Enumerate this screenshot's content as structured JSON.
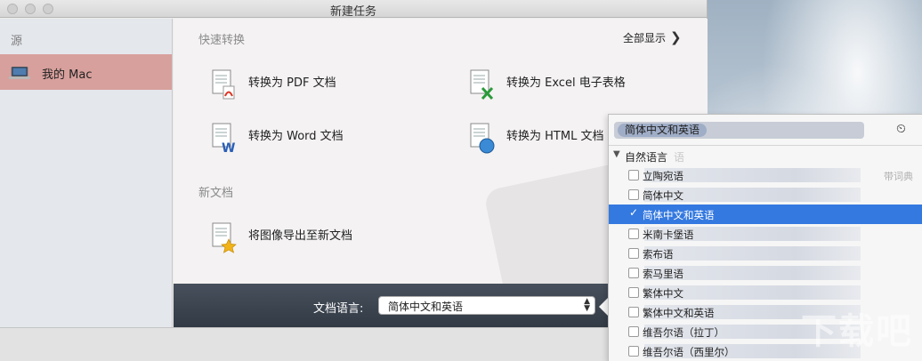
{
  "window": {
    "title": "新建任务"
  },
  "sidebar": {
    "header": "源",
    "items": [
      {
        "label": "我的 Mac",
        "icon": "laptop-icon",
        "selected": true
      }
    ]
  },
  "quick_convert": {
    "title": "快速转换",
    "show_all": "全部显示",
    "actions": [
      {
        "label": "转换为 PDF 文档",
        "icon": "pdf-doc-icon"
      },
      {
        "label": "转换为 Excel 电子表格",
        "icon": "excel-doc-icon"
      },
      {
        "label": "转换为 Word 文档",
        "icon": "word-doc-icon"
      },
      {
        "label": "转换为 HTML 文档",
        "icon": "html-doc-icon"
      }
    ]
  },
  "new_document": {
    "title": "新文档",
    "actions": [
      {
        "label": "将图像导出至新文档",
        "icon": "image-export-icon"
      }
    ]
  },
  "bottombar": {
    "language_label": "文档语言:",
    "language_value": "简体中文和英语"
  },
  "popover": {
    "search_chip": "简体中文和英语",
    "group_label": "自然语言",
    "group_ghost": "语",
    "languages": [
      {
        "name": "立陶宛语",
        "checked": false,
        "selected": false,
        "dict": "带词典"
      },
      {
        "name": "简体中文",
        "checked": false,
        "selected": false
      },
      {
        "name": "简体中文和英语",
        "checked": true,
        "selected": true
      },
      {
        "name": "米南卡堡语",
        "checked": false,
        "selected": false
      },
      {
        "name": "索布语",
        "checked": false,
        "selected": false
      },
      {
        "name": "索马里语",
        "checked": false,
        "selected": false
      },
      {
        "name": "繁体中文",
        "checked": false,
        "selected": false
      },
      {
        "name": "繁体中文和英语",
        "checked": false,
        "selected": false
      },
      {
        "name": "维吾尔语（拉丁）",
        "checked": false,
        "selected": false
      },
      {
        "name": "维吾尔语（西里尔）",
        "checked": false,
        "selected": false
      }
    ]
  },
  "colors": {
    "sidebar_selected": "#d7a09c",
    "selection_blue": "#3479e0",
    "bottombar": "#3c4450"
  },
  "watermark": "下载吧"
}
